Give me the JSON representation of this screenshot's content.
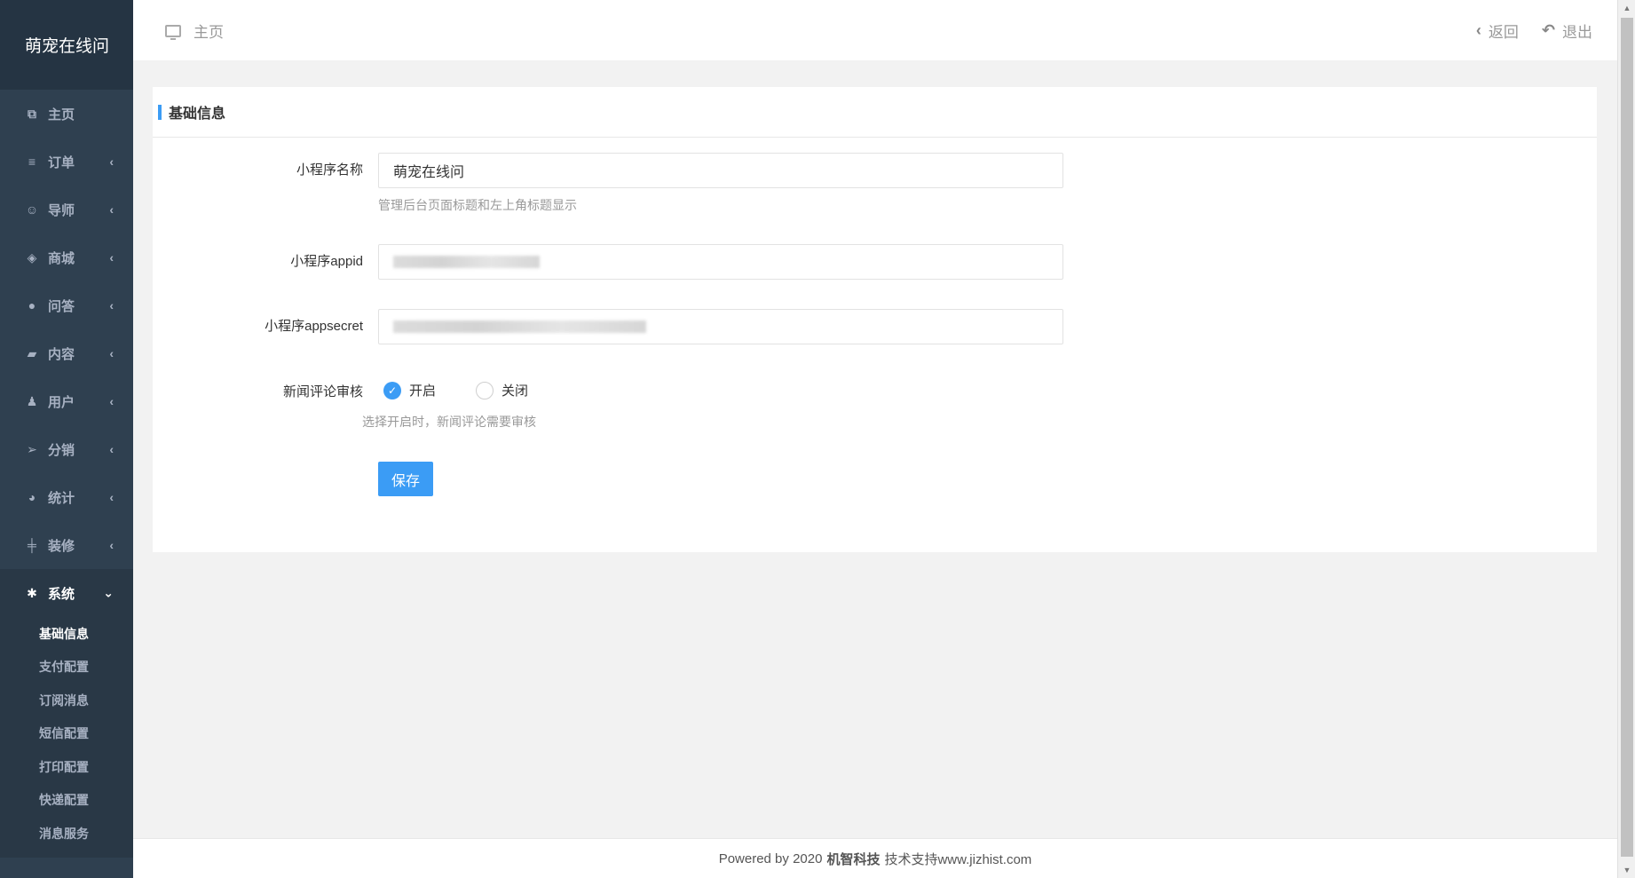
{
  "brand": "萌宠在线问",
  "sidebar": {
    "items": [
      {
        "label": "主页",
        "icon": "copy-icon",
        "has_arrow": false
      },
      {
        "label": "订单",
        "icon": "list-icon",
        "has_arrow": true
      },
      {
        "label": "导师",
        "icon": "user-icon",
        "has_arrow": true
      },
      {
        "label": "商城",
        "icon": "tags-icon",
        "has_arrow": true
      },
      {
        "label": "问答",
        "icon": "comment-icon",
        "has_arrow": true
      },
      {
        "label": "内容",
        "icon": "book-icon",
        "has_arrow": true
      },
      {
        "label": "用户",
        "icon": "person-icon",
        "has_arrow": true
      },
      {
        "label": "分销",
        "icon": "send-icon",
        "has_arrow": true
      },
      {
        "label": "统计",
        "icon": "pie-chart-icon",
        "has_arrow": true
      },
      {
        "label": "装修",
        "icon": "sliders-icon",
        "has_arrow": true
      }
    ],
    "open_item": {
      "label": "系统",
      "icon": "gear-icon"
    },
    "sub_items": [
      "基础信息",
      "支付配置",
      "订阅消息",
      "短信配置",
      "打印配置",
      "快递配置",
      "消息服务"
    ],
    "active_sub": "基础信息"
  },
  "topbar": {
    "breadcrumb": "主页",
    "back_label": "返回",
    "logout_label": "退出"
  },
  "panel": {
    "title": "基础信息",
    "fields": {
      "name_label": "小程序名称",
      "name_value": "萌宠在线问",
      "name_hint": "管理后台页面标题和左上角标题显示",
      "appid_label": "小程序appid",
      "appsecret_label": "小程序appsecret",
      "review_label": "新闻评论审核",
      "review_on": "开启",
      "review_off": "关闭",
      "review_selected": "开启",
      "review_hint": "选择开启时，新闻评论需要审核"
    },
    "save_label": "保存"
  },
  "footer": {
    "prefix": "Powered by 2020",
    "company": "机智科技",
    "suffix": "技术支持www.jizhist.com"
  },
  "colors": {
    "sidebar_bg": "#2f4050",
    "accent": "#3b9cf5"
  }
}
